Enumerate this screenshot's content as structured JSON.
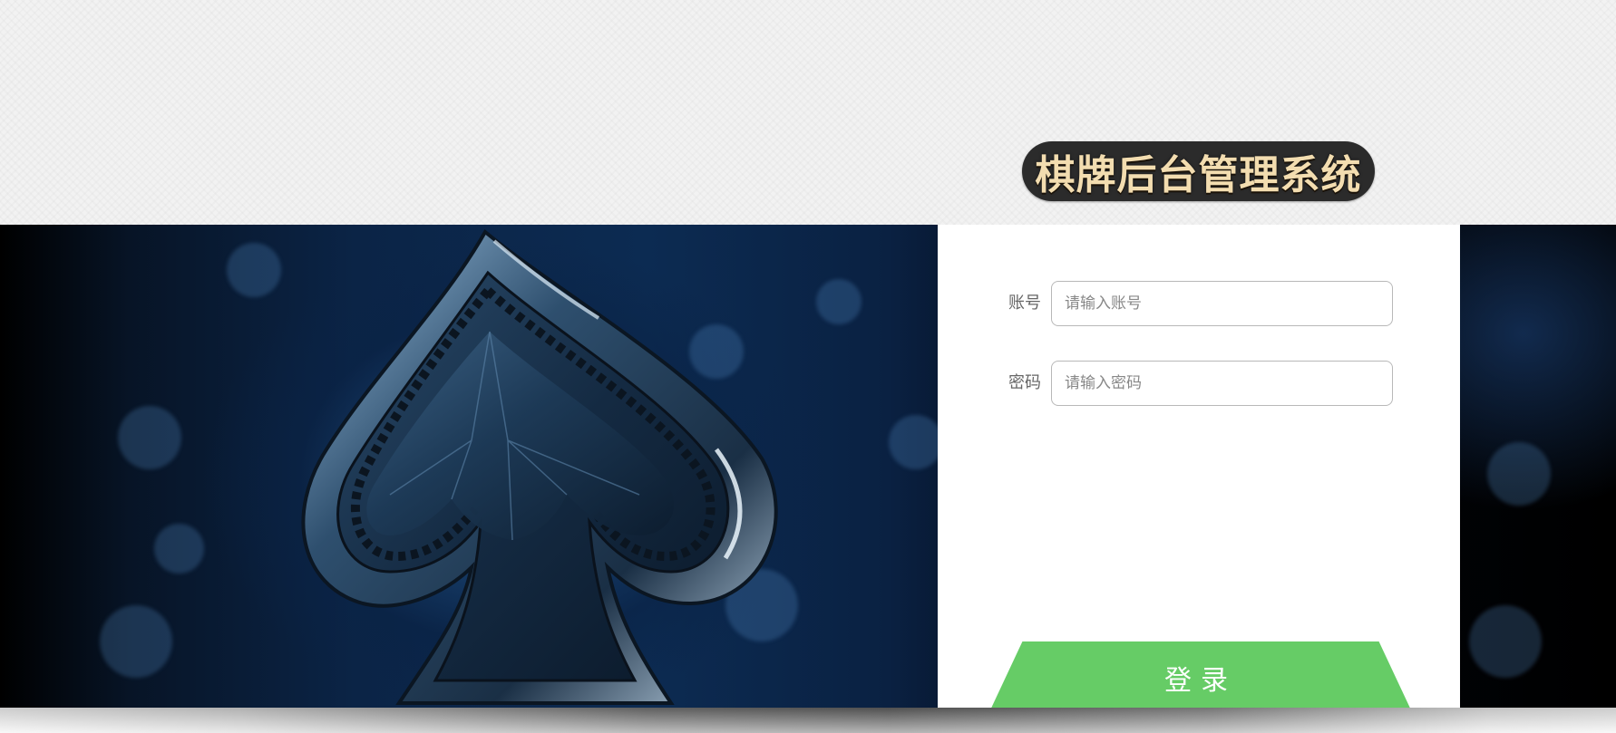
{
  "header": {
    "title": "棋牌后台管理系统"
  },
  "hero": {
    "image": "spade-card-suit-artwork"
  },
  "login": {
    "account": {
      "label": "账号",
      "placeholder": "请输入账号",
      "value": ""
    },
    "password": {
      "label": "密码",
      "placeholder": "请输入密码",
      "value": ""
    },
    "submit_label": "登录"
  },
  "colors": {
    "title_bg": "#2b2b2b",
    "title_text": "#f3ddb0",
    "button_bg": "#66cc66",
    "panel_bg": "#ffffff"
  }
}
